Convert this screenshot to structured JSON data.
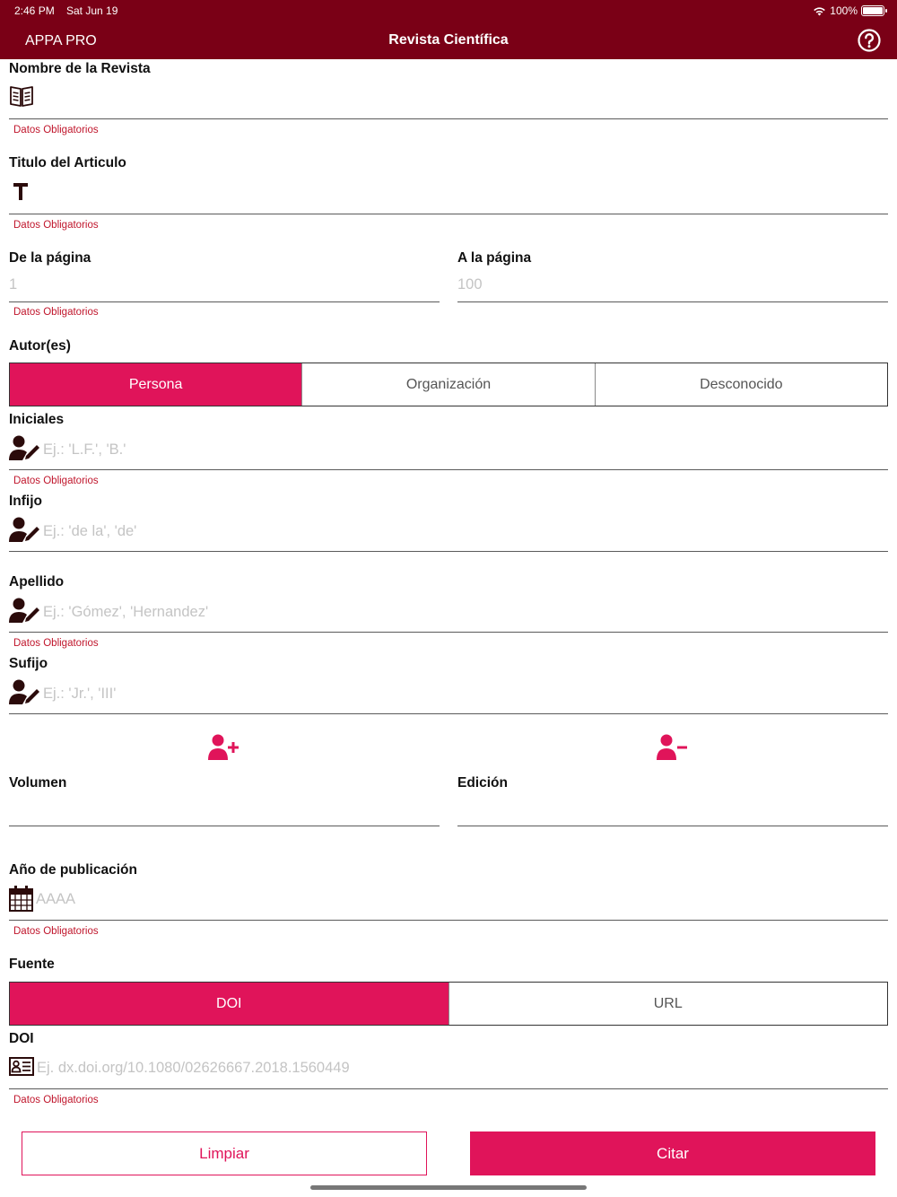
{
  "status": {
    "time": "2:46 PM",
    "date": "Sat Jun 19",
    "battery": "100%"
  },
  "nav": {
    "app_name": "APPA PRO",
    "title": "Revista Científica",
    "help_icon": "question-circle-icon"
  },
  "required_text": "Datos Obligatorios",
  "form": {
    "journal_name": {
      "label": "Nombre de la Revista",
      "icon": "book-icon"
    },
    "article_title": {
      "label": "Titulo del Articulo",
      "icon": "text-t-icon"
    },
    "page_from": {
      "label": "De la página",
      "placeholder": "1"
    },
    "page_to": {
      "label": "A la página",
      "placeholder": "100"
    },
    "authors": {
      "label": "Autor(es)",
      "types": [
        "Persona",
        "Organización",
        "Desconocido"
      ],
      "selected": "Persona"
    },
    "initials": {
      "label": "Iniciales",
      "placeholder": "Ej.: 'L.F.', 'B.'",
      "icon": "user-edit-icon"
    },
    "infix": {
      "label": "Infijo",
      "placeholder": "Ej.: 'de la', 'de'",
      "icon": "user-edit-icon"
    },
    "surname": {
      "label": "Apellido",
      "placeholder": "Ej.: 'Gómez', 'Hernandez'",
      "icon": "user-edit-icon"
    },
    "suffix": {
      "label": "Sufijo",
      "placeholder": "Ej.: 'Jr.', 'III'",
      "icon": "user-edit-icon"
    },
    "add_author_icon": "user-plus-icon",
    "remove_author_icon": "user-minus-icon",
    "volume": {
      "label": "Volumen"
    },
    "edition": {
      "label": "Edición"
    },
    "year": {
      "label": "Año de publicación",
      "placeholder": "AAAA",
      "icon": "calendar-icon"
    },
    "source": {
      "label": "Fuente",
      "types": [
        "DOI",
        "URL"
      ],
      "selected": "DOI"
    },
    "doi": {
      "label": "DOI",
      "placeholder": "Ej. dx.doi.org/10.1080/02626667.2018.1560449",
      "icon": "id-card-icon"
    }
  },
  "buttons": {
    "clear": "Limpiar",
    "cite": "Citar"
  },
  "colors": {
    "header": "#7a0016",
    "accent": "#e0145a",
    "required": "#c0162c"
  }
}
